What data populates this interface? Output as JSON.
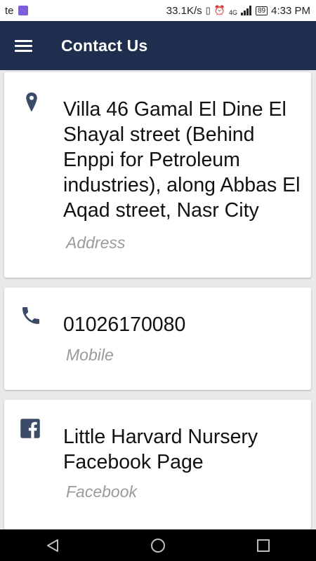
{
  "status_bar": {
    "carrier": "te",
    "speed": "33.1K/s",
    "network": "4G",
    "battery": "89",
    "time": "4:33 PM"
  },
  "app_bar": {
    "title": "Contact Us",
    "menu_icon": "hamburger-icon"
  },
  "contacts": [
    {
      "icon": "map-pin-icon",
      "value": "Villa 46 Gamal El Dine El Shayal street (Behind Enppi for Petroleum industries), along Abbas El Aqad street, Nasr City",
      "label": "Address"
    },
    {
      "icon": "phone-icon",
      "value": "01026170080",
      "label": "Mobile"
    },
    {
      "icon": "facebook-icon",
      "value": "Little Harvard Nursery Facebook Page",
      "label": "Facebook"
    }
  ],
  "nav_bar": {
    "back_icon": "back-triangle-icon",
    "home_icon": "home-circle-icon",
    "recents_icon": "recents-square-icon"
  },
  "colors": {
    "app_bar": "#1f2d4f",
    "icon": "#3b4a66",
    "label": "#9a9a9a"
  }
}
